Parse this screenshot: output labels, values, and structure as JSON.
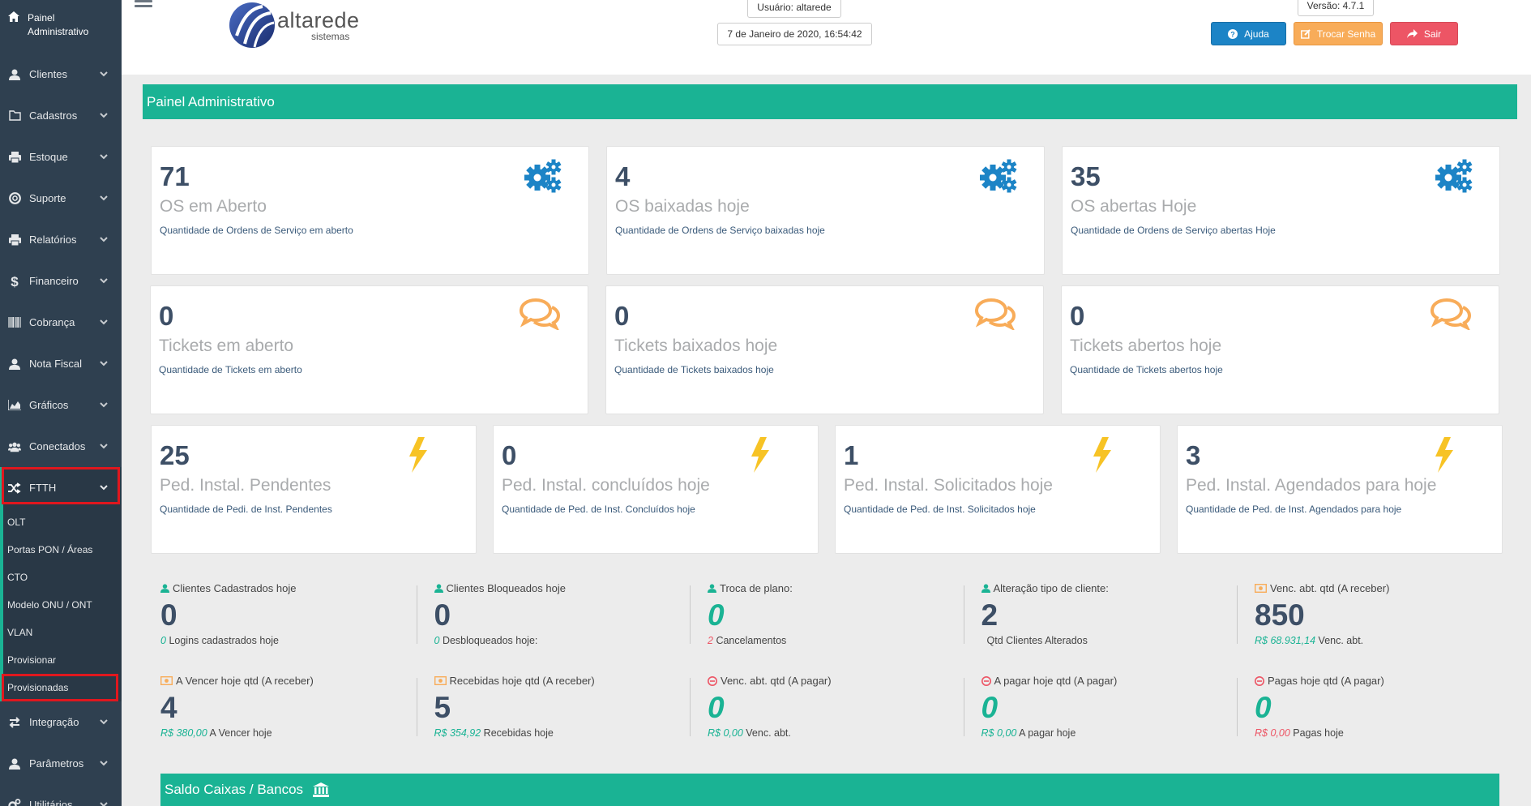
{
  "sidebar": {
    "top_label": "Painel Administrativo",
    "items": [
      {
        "label": "Clientes",
        "icon": "user-icon"
      },
      {
        "label": "Cadastros",
        "icon": "folder-icon"
      },
      {
        "label": "Estoque",
        "icon": "print-icon"
      },
      {
        "label": "Suporte",
        "icon": "lifebuoy-icon"
      },
      {
        "label": "Relatórios",
        "icon": "print-icon"
      },
      {
        "label": "Financeiro",
        "icon": "dollar-icon"
      },
      {
        "label": "Cobrança",
        "icon": "barcode-icon"
      },
      {
        "label": "Nota Fiscal",
        "icon": "user-icon"
      },
      {
        "label": "Gráficos",
        "icon": "area-chart-icon"
      },
      {
        "label": "Conectados",
        "icon": "users-icon"
      }
    ],
    "active": {
      "label": "FTTH",
      "icon": "random-icon"
    },
    "submenu": [
      "OLT",
      "Portas PON / Áreas",
      "CTO",
      "Modelo ONU / ONT",
      "VLAN",
      "Provisionar",
      "Provisionadas"
    ],
    "after": [
      {
        "label": "Integração",
        "icon": "exchange-icon"
      },
      {
        "label": "Parâmetros",
        "icon": "user-icon"
      },
      {
        "label": "Utilitários",
        "icon": "cogs-icon"
      }
    ]
  },
  "topbar": {
    "logo_name": "altarede",
    "logo_sub": "sistemas",
    "user": "Usuário: altarede",
    "datetime": "7 de Janeiro de 2020, 16:54:42",
    "version": "Versão: 4.7.1",
    "help": "Ajuda",
    "change_password": "Trocar Senha",
    "logout": "Sair"
  },
  "page_title": "Painel Administrativo",
  "cards_os": [
    {
      "num": "71",
      "title": "OS em Aberto",
      "desc": "Quantidade de Ordens de Serviço em aberto"
    },
    {
      "num": "4",
      "title": "OS baixadas hoje",
      "desc": "Quantidade de Ordens de Serviço baixadas hoje"
    },
    {
      "num": "35",
      "title": "OS abertas Hoje",
      "desc": "Quantidade de Ordens de Serviço abertas Hoje"
    }
  ],
  "cards_tickets": [
    {
      "num": "0",
      "title": "Tickets em aberto",
      "desc": "Quantidade de Tickets em aberto"
    },
    {
      "num": "0",
      "title": "Tickets baixados hoje",
      "desc": "Quantidade de Tickets baixados hoje"
    },
    {
      "num": "0",
      "title": "Tickets abertos hoje",
      "desc": "Quantidade de Tickets abertos hoje"
    }
  ],
  "cards_instal": [
    {
      "num": "25",
      "title": "Ped. Instal. Pendentes",
      "desc": "Quantidade de Pedi. de Inst. Pendentes"
    },
    {
      "num": "0",
      "title": "Ped. Instal. concluídos hoje",
      "desc": "Quantidade de Ped. de Inst. Concluídos hoje"
    },
    {
      "num": "1",
      "title": "Ped. Instal. Solicitados hoje",
      "desc": "Quantidade de Ped. de Inst. Solicitados hoje"
    },
    {
      "num": "3",
      "title": "Ped. Instal. Agendados para hoje",
      "desc": "Quantidade de Ped. de Inst. Agendados para hoje"
    }
  ],
  "stats_row1": [
    {
      "label": "Clientes Cadastrados hoje",
      "value": "0",
      "sub_hl": "0",
      "sub_text": "Logins cadastrados hoje",
      "icon": "user-icon"
    },
    {
      "label": "Clientes Bloqueados hoje",
      "value": "0",
      "sub_hl": "0",
      "sub_text": "Desbloqueados hoje:",
      "icon": "user-icon"
    },
    {
      "label": "Troca de plano:",
      "value": "0",
      "sub_hl": "2",
      "sub_text": "Cancelamentos",
      "icon": "user-icon"
    },
    {
      "label": "Alteração tipo de cliente:",
      "value": "2",
      "sub_hl": "",
      "sub_text": "Qtd Clientes Alterados",
      "icon": "user-icon"
    },
    {
      "label": "Venc. abt. qtd (A receber)",
      "value": "850",
      "sub_hl": "R$ 68.931,14",
      "sub_text": "Venc. abt.",
      "icon": "money-icon"
    }
  ],
  "stats_row2": [
    {
      "label": "A Vencer hoje qtd (A receber)",
      "value": "4",
      "sub_hl": "R$ 380,00",
      "sub_text": "A Vencer hoje",
      "icon": "money-icon"
    },
    {
      "label": "Recebidas hoje qtd (A receber)",
      "value": "5",
      "sub_hl": "R$ 354,92",
      "sub_text": "Recebidas hoje",
      "icon": "money-icon"
    },
    {
      "label": "Venc. abt. qtd (A pagar)",
      "value": "0",
      "sub_hl": "R$ 0,00",
      "sub_text": "Venc. abt.",
      "icon": "minus-circle-icon"
    },
    {
      "label": "A pagar hoje qtd (A pagar)",
      "value": "0",
      "sub_hl": "R$ 0,00",
      "sub_text": "A pagar hoje",
      "icon": "minus-circle-icon"
    },
    {
      "label": "Pagas hoje qtd (A pagar)",
      "value": "0",
      "sub_hl": "R$ 0,00",
      "sub_text": "Pagas hoje",
      "icon": "minus-circle-icon"
    }
  ],
  "saldo_title": "Saldo Caixas / Bancos",
  "colors": {
    "accent": "#1ab394",
    "sidebar": "#2f4050",
    "blue": "#1c84c6",
    "orange": "#f8ac59",
    "red": "#ed5565",
    "highlight": "#e0171e"
  }
}
